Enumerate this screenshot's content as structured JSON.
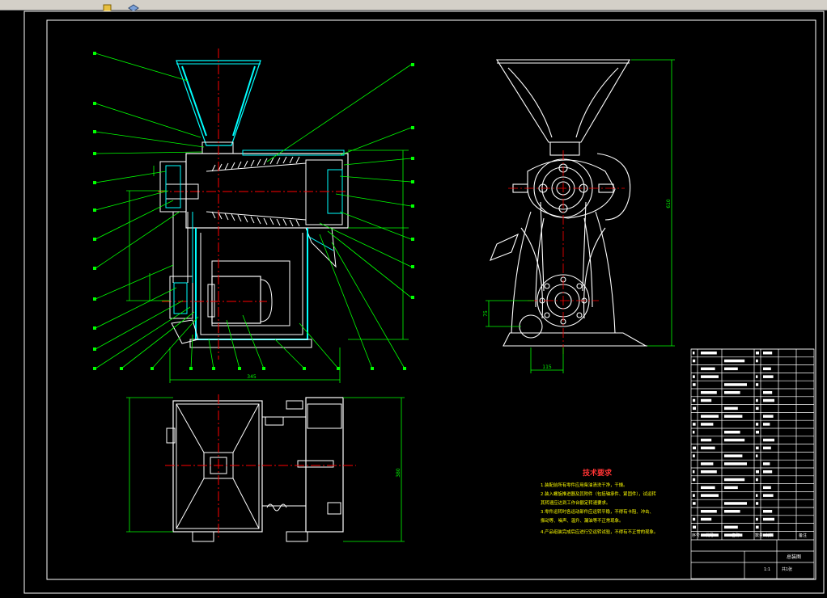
{
  "toolbar": {
    "icons": [
      "tool-icon",
      "layer-icon"
    ]
  },
  "colors": {
    "background": "#000000",
    "frame": "#ffffff",
    "outline": "#ffffff",
    "section": "#00ffff",
    "leader": "#00ff00",
    "center_line": "#ff0000",
    "hatch": "#ffffff",
    "dimension": "#00ff00",
    "notes": "#ffff00",
    "notes_title": "#ff3333"
  },
  "drawing": {
    "dimensions": {
      "front_width": "345",
      "side_height": "610",
      "top_height": "380",
      "side_base": "115",
      "side_small": "75"
    },
    "tech_notes": {
      "title": "技术要求",
      "lines": [
        "1.装配前所有零件应用柴油清洗干净，干燥。",
        "2.装入螺旋推进器及其附件（包括轴承件、紧固件），试运转",
        "  其转速应达到工作台额定转速要求。",
        "3.零件运转时各运动部件应运转平稳，不得有卡阻、冲击、",
        "  振动等、噪声、温升、漏油等不正常现象。",
        "4.产品组装完成后应进行空运转试验，不得有不正常的现象。"
      ]
    },
    "title_block": {
      "header_cols": [
        "序号",
        "代号",
        "名称",
        "数量",
        "材料",
        "备注"
      ],
      "drawing_name": "总装图",
      "scale": "1:1",
      "sheet": "共1张"
    }
  }
}
